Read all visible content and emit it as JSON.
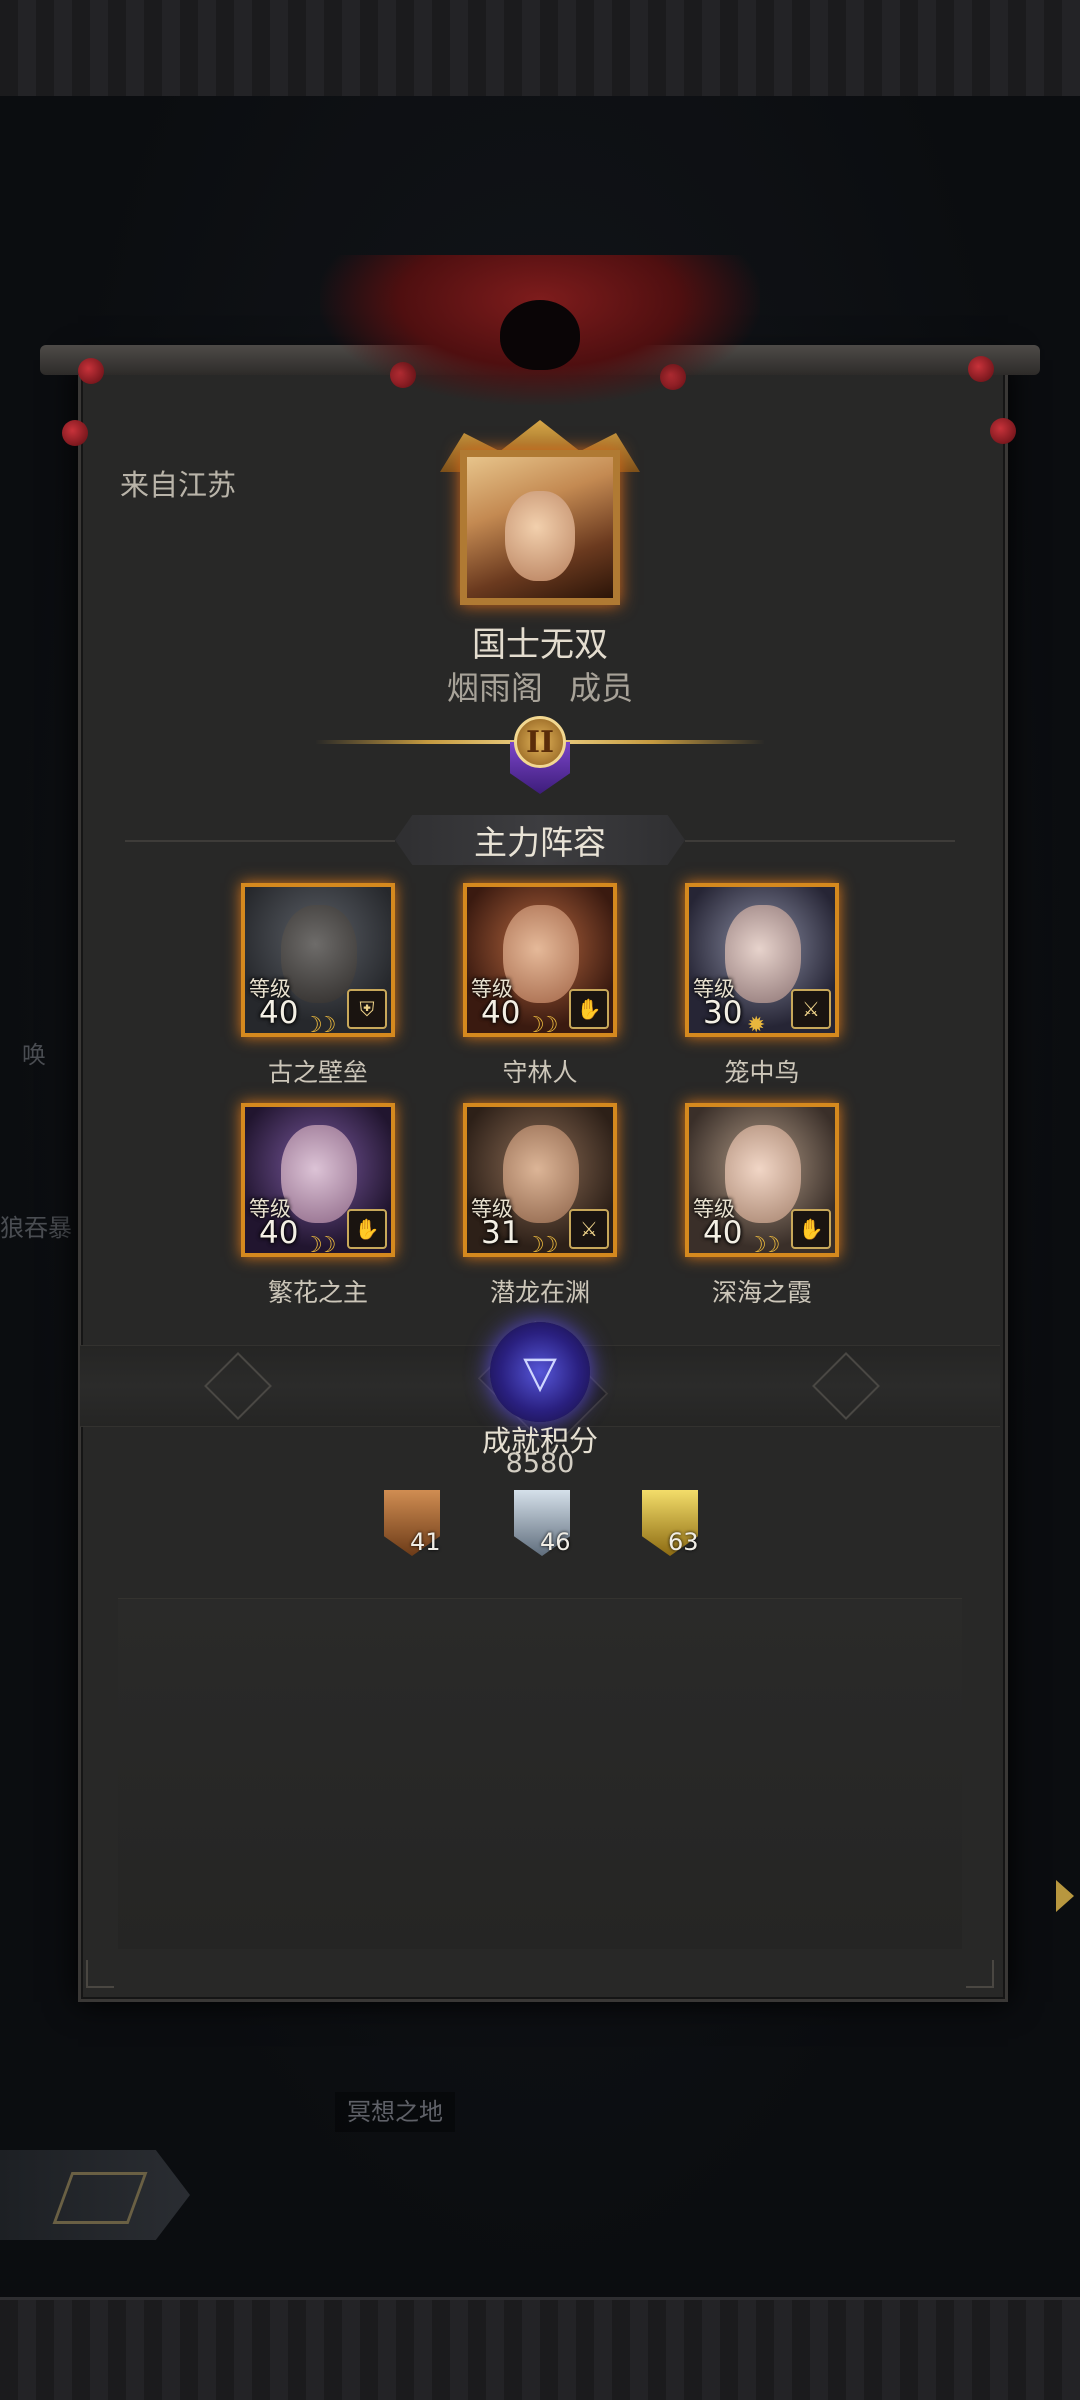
{
  "background": {
    "location_label": "冥想之地",
    "side_texts": [
      "唤",
      "狼吞暴"
    ]
  },
  "profile": {
    "origin": "来自江苏",
    "name": "国士无双",
    "guild": "烟雨阁",
    "role": "成员",
    "rank": "II"
  },
  "lineup": {
    "title": "主力阵容",
    "level_label": "等级",
    "heroes": [
      {
        "name": "古之壁垒",
        "level": "40",
        "class_icon": "shield-icon"
      },
      {
        "name": "守林人",
        "level": "40",
        "class_icon": "hand-icon"
      },
      {
        "name": "笼中鸟",
        "level": "30",
        "class_icon": "crossed-icon"
      },
      {
        "name": "繁花之主",
        "level": "40",
        "class_icon": "hand-icon"
      },
      {
        "name": "潜龙在渊",
        "level": "31",
        "class_icon": "crossed-icon"
      },
      {
        "name": "深海之霞",
        "level": "40",
        "class_icon": "hand-icon"
      }
    ]
  },
  "achievements": {
    "title": "成就积分",
    "points": "8580",
    "medals": [
      {
        "tier": "bronze",
        "count": "41",
        "color": "#b9763f"
      },
      {
        "tier": "silver",
        "count": "46",
        "color": "#a9b6c6"
      },
      {
        "tier": "gold",
        "count": "63",
        "color": "#d8b541"
      }
    ]
  }
}
